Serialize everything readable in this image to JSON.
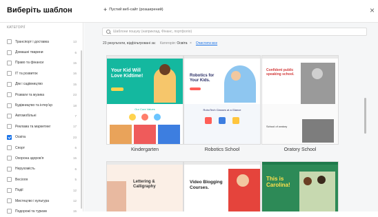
{
  "header": {
    "title": "Виберіть шаблон",
    "blank_site_label": "Пустий веб-сайт (розширений)",
    "close_icon": "×"
  },
  "sidebar": {
    "heading": "КАТЕГОРІЇ",
    "items": [
      {
        "label": "Транспорт і доставка",
        "count": "13",
        "checked": false
      },
      {
        "label": "Домашні тварини",
        "count": "6",
        "checked": false
      },
      {
        "label": "Право та фінанси",
        "count": "15",
        "checked": false
      },
      {
        "label": "IT та розвиток",
        "count": "16",
        "checked": false
      },
      {
        "label": "Дім і садівництво",
        "count": "15",
        "checked": false
      },
      {
        "label": "Розваги та музика",
        "count": "23",
        "checked": false
      },
      {
        "label": "Будівництво та інтер'єр",
        "count": "18",
        "checked": false
      },
      {
        "label": "Автомобільні",
        "count": "7",
        "checked": false
      },
      {
        "label": "Реклама та маркетинг",
        "count": "17",
        "checked": false
      },
      {
        "label": "Освіта",
        "count": "23",
        "checked": true
      },
      {
        "label": "Спорт",
        "count": "6",
        "checked": false
      },
      {
        "label": "Охорона здоров'я",
        "count": "15",
        "checked": false
      },
      {
        "label": "Нерухомість",
        "count": "6",
        "checked": false
      },
      {
        "label": "Весілля",
        "count": "5",
        "checked": false
      },
      {
        "label": "Події",
        "count": "12",
        "checked": false
      },
      {
        "label": "Мистецтво і культура",
        "count": "12",
        "checked": false
      },
      {
        "label": "Подорожі та туризм",
        "count": "15",
        "checked": false
      }
    ]
  },
  "search": {
    "placeholder": "Шаблони пошуку (наприклад, Фінанс, портфоліо)"
  },
  "filters": {
    "results_text": "23 результати, відфільтровані за:",
    "tag_label": "Категорія:",
    "tag_value": "Освіта",
    "tag_remove": "×",
    "clear_all": "Очистити все"
  },
  "templates": [
    {
      "name": "Kindergarten",
      "hero_text": "Your Kid Will Love Kidtime!",
      "sub_text": "Our Core Values"
    },
    {
      "name": "Robotics School",
      "hero_text": "Robotics for Your Kids.",
      "sub_text": "RoboTech Classes at a Glance"
    },
    {
      "name": "Oratory School",
      "hero_text": "Confident public speaking school.",
      "sub_text": "School of oratory"
    },
    {
      "name": "",
      "hero_text": "Lettering & Calligraphy",
      "sub_text": ""
    },
    {
      "name": "",
      "hero_text": "Video Blogging Courses.",
      "sub_text": ""
    },
    {
      "name": "",
      "hero_text": "This is Carolina!",
      "sub_text": ""
    }
  ],
  "colors": {
    "accent": "#1a73e8",
    "kinder_teal": "#14b89f",
    "video_red": "#e5443c",
    "carolina_green": "#1f7a4b"
  }
}
